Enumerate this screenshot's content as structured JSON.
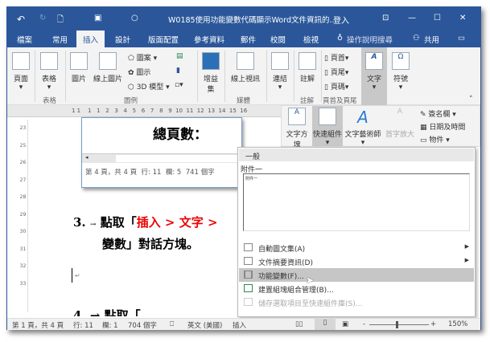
{
  "title_bar": {
    "title": "W0185使用功能變數代碼顯示Word文件資訊的...",
    "signin": "登入",
    "undo": "↶",
    "redo": "↻",
    "minimize": "—",
    "maximize": "☐",
    "close": "✕"
  },
  "tabs": [
    "檔案",
    "常用",
    "插入",
    "設計",
    "版面配置",
    "參考資料",
    "郵件",
    "校閱",
    "檢視"
  ],
  "tell_me": "操作說明搜尋",
  "share": "共用",
  "ribbon": {
    "pages": "頁面",
    "table": "表格",
    "pictures": "圖片",
    "online_pictures": "線上圖片",
    "shapes": "圖案",
    "icons": "圖示",
    "models3d": "3D 模型",
    "addins": "增益集",
    "online_video": "線上視訊",
    "links": "連結",
    "comment": "註解",
    "header": "頁首",
    "footer": "頁尾",
    "page_number": "頁碼",
    "text": "文字",
    "symbols": "符號",
    "groups": {
      "tables": "表格",
      "illustrations": "圖例",
      "media": "媒體",
      "comments": "註解",
      "header_footer": "頁首及頁尾"
    }
  },
  "ruler": "1 1    1   1   2   3   4   5   6   7   8   9  10  11  12  13  14  15  16",
  "vruler": [
    "23",
    "24",
    "25",
    "26",
    "27",
    "28",
    "29",
    "30",
    "31",
    "32",
    "33"
  ],
  "text_panel": {
    "textbox": "文字方塊",
    "quickparts": "快速組件",
    "wordart": "文字藝術師",
    "dropcap": "首字放大",
    "signature": "簽名欄",
    "datetime": "日期及時間",
    "object": "物件"
  },
  "inset": {
    "text": "總頁數：",
    "status": {
      "page": "第 4 頁，共 4 頁",
      "line": "行: 11",
      "col": "欄: 5",
      "words": "741 個字"
    }
  },
  "document": {
    "step_num": "3.",
    "arrow": "→",
    "line1a": "點取「",
    "line1b": "插入 > 文字 >",
    "line2": "變數」對話方塊。",
    "para": "↵",
    "line4": "4.  → 點取「"
  },
  "menu": {
    "header": "一般",
    "item_title": "附件一",
    "preview": "附件一",
    "items": [
      {
        "label": "自動圖文集(A)",
        "submenu": true
      },
      {
        "label": "文件摘要資訊(D)",
        "submenu": true
      },
      {
        "label": "功能變數(F)...",
        "highlighted": true
      },
      {
        "label": "建置組塊組合管理(B)..."
      },
      {
        "label": "儲存選取項目至快速組件庫(S)...",
        "disabled": true
      }
    ]
  },
  "status": {
    "page": "第 1 頁，共 4 頁",
    "line": "行: 11",
    "col": "欄: 1",
    "words": "704 個字",
    "lang": "英文 (美國)",
    "mode": "插入",
    "zoom_minus": "-",
    "zoom_plus": "+",
    "zoom": "150%"
  }
}
